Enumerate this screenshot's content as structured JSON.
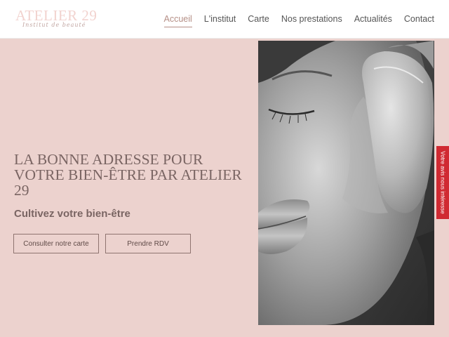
{
  "header": {
    "logo_text": "ATELIER 29",
    "logo_subtext": "Institut de beauté"
  },
  "nav": {
    "items": [
      "Accueil",
      "L'institut",
      "Carte",
      "Nos prestations",
      "Actualités",
      "Contact"
    ],
    "active": "Accueil"
  },
  "hero": {
    "title": "LA BONNE ADRESSE POUR VOTRE BIEN-ÊTRE PAR ATELIER 29",
    "subtitle": "Cultivez votre bien-être",
    "buttons": {
      "carte": "Consulter notre carte",
      "rdv": "Prendre RDV"
    },
    "image_icon": "face-with-gua-sha-stone-photo"
  },
  "side_tab": {
    "label": "Votre avis nous intéresse"
  },
  "colors": {
    "hero_bg": "#ecd2ce",
    "accent": "#b58f86",
    "title_text": "#7a6563",
    "side_tab_bg": "#d02a32"
  }
}
